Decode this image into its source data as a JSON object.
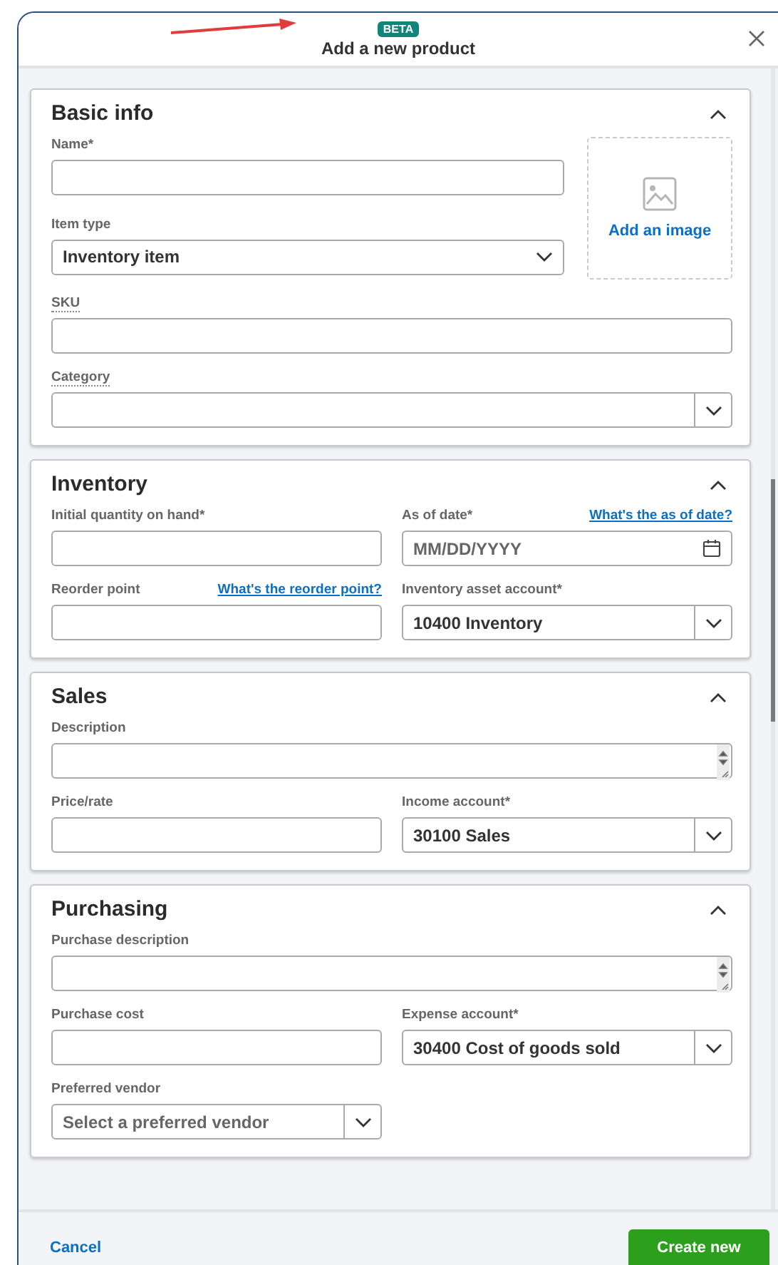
{
  "dialog": {
    "badge": "BETA",
    "title": "Add a new product"
  },
  "sections": [
    {
      "title": "Basic info",
      "expanded": true,
      "image_upload": {
        "label": "Add an image"
      },
      "rows": [
        [
          {
            "label": "Name*",
            "kind": "text"
          }
        ],
        [
          {
            "label": "Item type",
            "kind": "select",
            "value": "Inventory item"
          }
        ],
        [
          {
            "label": "SKU",
            "kind": "text",
            "tooltip": true
          }
        ],
        [
          {
            "label": "Category",
            "kind": "combo",
            "tooltip": true
          }
        ]
      ]
    },
    {
      "title": "Inventory",
      "expanded": true,
      "rows": [
        [
          {
            "label": "Initial quantity on hand*",
            "kind": "text"
          },
          {
            "label": "As of date*",
            "kind": "date",
            "placeholder": "MM/DD/YYYY",
            "help_link": "What's the as of date?"
          }
        ],
        [
          {
            "label": "Reorder point",
            "kind": "text",
            "help_link": "What's the reorder point?"
          },
          {
            "label": "Inventory asset account*",
            "kind": "combo",
            "value": "10400 Inventory"
          }
        ]
      ]
    },
    {
      "title": "Sales",
      "expanded": true,
      "rows": [
        [
          {
            "label": "Description",
            "kind": "textarea",
            "wide": true
          }
        ],
        [
          {
            "label": "Price/rate",
            "kind": "text"
          },
          {
            "label": "Income account*",
            "kind": "combo",
            "value": "30100 Sales"
          }
        ]
      ]
    },
    {
      "title": "Purchasing",
      "expanded": true,
      "rows": [
        [
          {
            "label": "Purchase description",
            "kind": "textarea",
            "wide": true
          }
        ],
        [
          {
            "label": "Purchase cost",
            "kind": "text"
          },
          {
            "label": "Expense account*",
            "kind": "combo",
            "value": "30400 Cost of goods sold"
          }
        ],
        [
          {
            "label": "Preferred vendor",
            "kind": "combo",
            "placeholder": "Select a preferred vendor"
          }
        ]
      ]
    }
  ],
  "footer": {
    "cancel": "Cancel",
    "submit": "Create new"
  }
}
